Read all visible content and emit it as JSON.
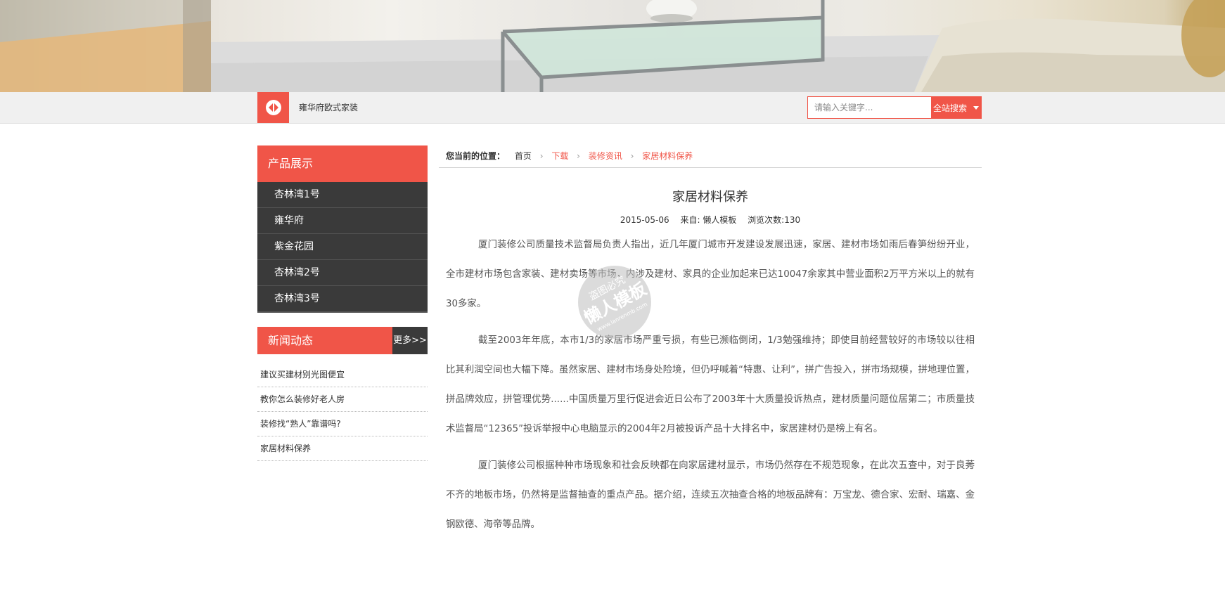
{
  "header": {
    "site_name": "雍华府欧式家装",
    "search": {
      "placeholder": "请输入关键字...",
      "button_label": "全站搜索"
    }
  },
  "sidebar": {
    "products_title": "产品展示",
    "products": [
      "杏林湾1号",
      "雍华府",
      "紫金花园",
      "杏林湾2号",
      "杏林湾3号"
    ],
    "news_title": "新闻动态",
    "news_more": "更多>>",
    "news": [
      "建议买建材别光图便宜",
      "教你怎么装修好老人房",
      "装修找“熟人”靠谱吗?",
      "家居材料保养"
    ]
  },
  "breadcrumb": {
    "label": "您当前的位置：",
    "items": [
      "首页",
      "下载",
      "装修资讯",
      "家居材料保养"
    ]
  },
  "article": {
    "title": "家居材料保养",
    "date": "2015-05-06",
    "source": "来自: 懒人模板",
    "views": "浏览次数:130",
    "paragraphs": [
      "厦门装修公司质量技术监督局负责人指出，近几年厦门城市开发建设发展迅速，家居、建材市场如雨后春笋纷纷开业，全市建材市场包含家装、建材卖场等市场，内涉及建材、家具的企业加起来已达10047余家其中营业面积2万平方米以上的就有30多家。",
      "截至2003年年底，本市1/3的家居市场严重亏损，有些已濒临倒闭，1/3勉强维持；即使目前经营较好的市场较以往相比其利润空间也大幅下降。虽然家居、建材市场身处险境，但仍呼喊着“特惠、让利”，拼广告投入，拼市场规模，拼地理位置，拼品牌效应，拼管理优势......中国质量万里行促进会近日公布了2003年十大质量投诉热点，建材质量问题位居第二；市质量技术监督局“12365”投诉举报中心电脑显示的2004年2月被投诉产品十大排名中，家居建材仍是榜上有名。",
      "厦门装修公司根据种种市场现象和社会反映都在向家居建材显示，市场仍然存在不规范现象，在此次五查中，对于良莠不齐的地板市场，仍然将是监督抽查的重点产品。据介绍，连续五次抽查合格的地板品牌有：万宝龙、德合家、宏耐、瑞嘉、金钢欧德、海帝等品牌。"
    ]
  },
  "watermark": {
    "line1": "盗图必究",
    "line2": "懒人模板",
    "line3": "www.lanrenmb.com"
  },
  "colors": {
    "accent": "#f05548",
    "dark": "#3a3a3a"
  }
}
